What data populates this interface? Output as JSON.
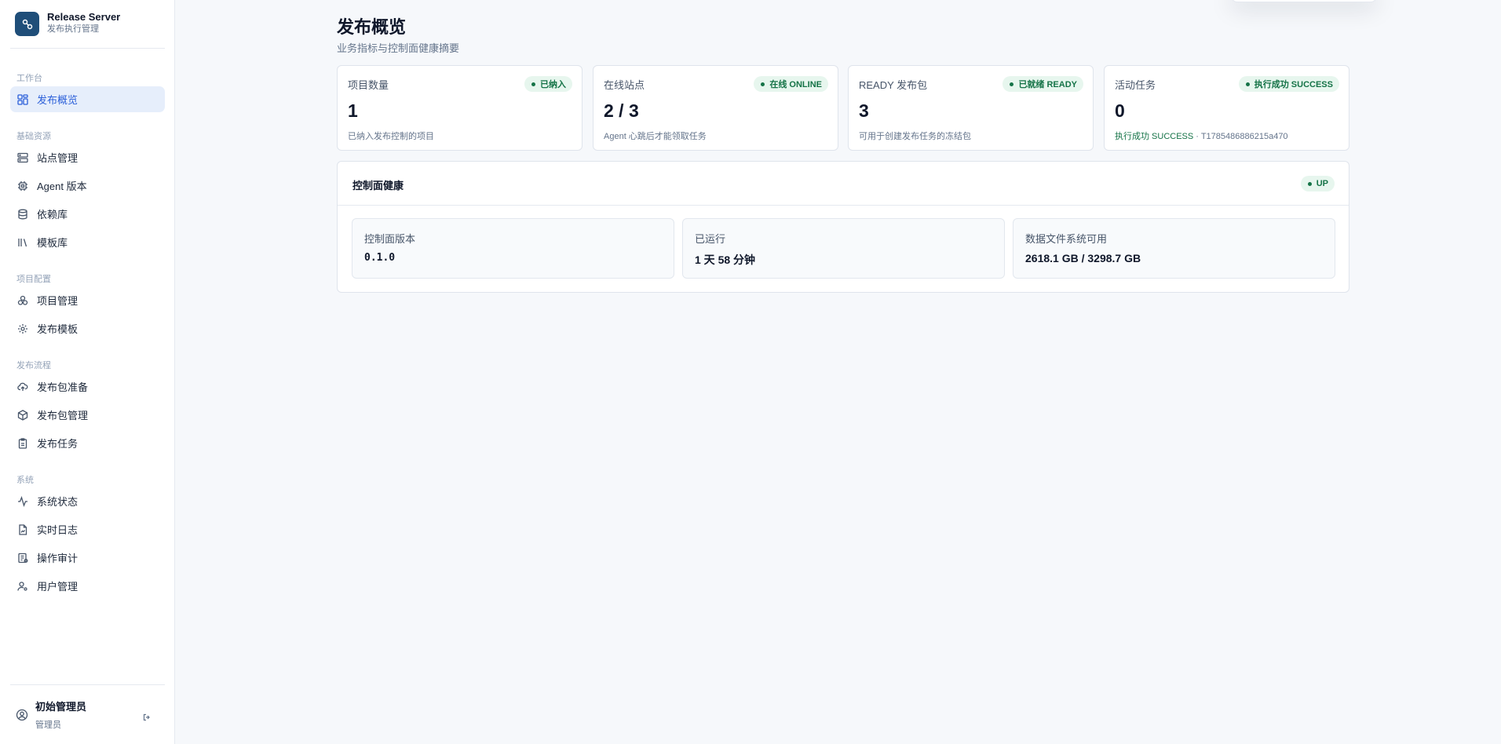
{
  "brand": {
    "title": "Release Server",
    "subtitle": "发布执行管理"
  },
  "sidebar": {
    "groups": {
      "workbench": "工作台",
      "resources": "基础资源",
      "projects": "项目配置",
      "flow": "发布流程",
      "system": "系统"
    },
    "items": {
      "overview": "发布概览",
      "sites": "站点管理",
      "agent": "Agent 版本",
      "deps": "依赖库",
      "templates_lib": "模板库",
      "projects": "项目管理",
      "release_templates": "发布模板",
      "package_prep": "发布包准备",
      "package_mgmt": "发布包管理",
      "tasks": "发布任务",
      "status": "系统状态",
      "logs": "实时日志",
      "audit": "操作审计",
      "users": "用户管理"
    }
  },
  "user": {
    "name": "初始管理员",
    "role": "管理员"
  },
  "page": {
    "title": "发布概览",
    "subtitle": "业务指标与控制面健康摘要"
  },
  "cards": [
    {
      "label": "项目数量",
      "badge": "已纳入",
      "value": "1",
      "desc": "已纳入发布控制的项目"
    },
    {
      "label": "在线站点",
      "badge": "在线 ONLINE",
      "value": "2 / 3",
      "desc": "Agent 心跳后才能领取任务"
    },
    {
      "label": "READY 发布包",
      "badge": "已就绪 READY",
      "value": "3",
      "desc": "可用于创建发布任务的冻结包"
    },
    {
      "label": "活动任务",
      "badge": "执行成功 SUCCESS",
      "value": "0",
      "desc_status": "执行成功 SUCCESS",
      "desc_sep": " · ",
      "desc_id": "T1785486886215a470"
    }
  ],
  "health": {
    "title": "控制面健康",
    "badge": "UP",
    "metrics": [
      {
        "label": "控制面版本",
        "value": "0.1.0"
      },
      {
        "label": "已运行",
        "value": "1 天 58 分钟"
      },
      {
        "label": "数据文件系统可用",
        "value": "2618.1 GB / 3298.7 GB"
      }
    ]
  },
  "colors": {
    "accent": "#2b5fd9",
    "brand": "#1f4e79",
    "success": "#157347",
    "success_bg": "#e7f6ee"
  }
}
